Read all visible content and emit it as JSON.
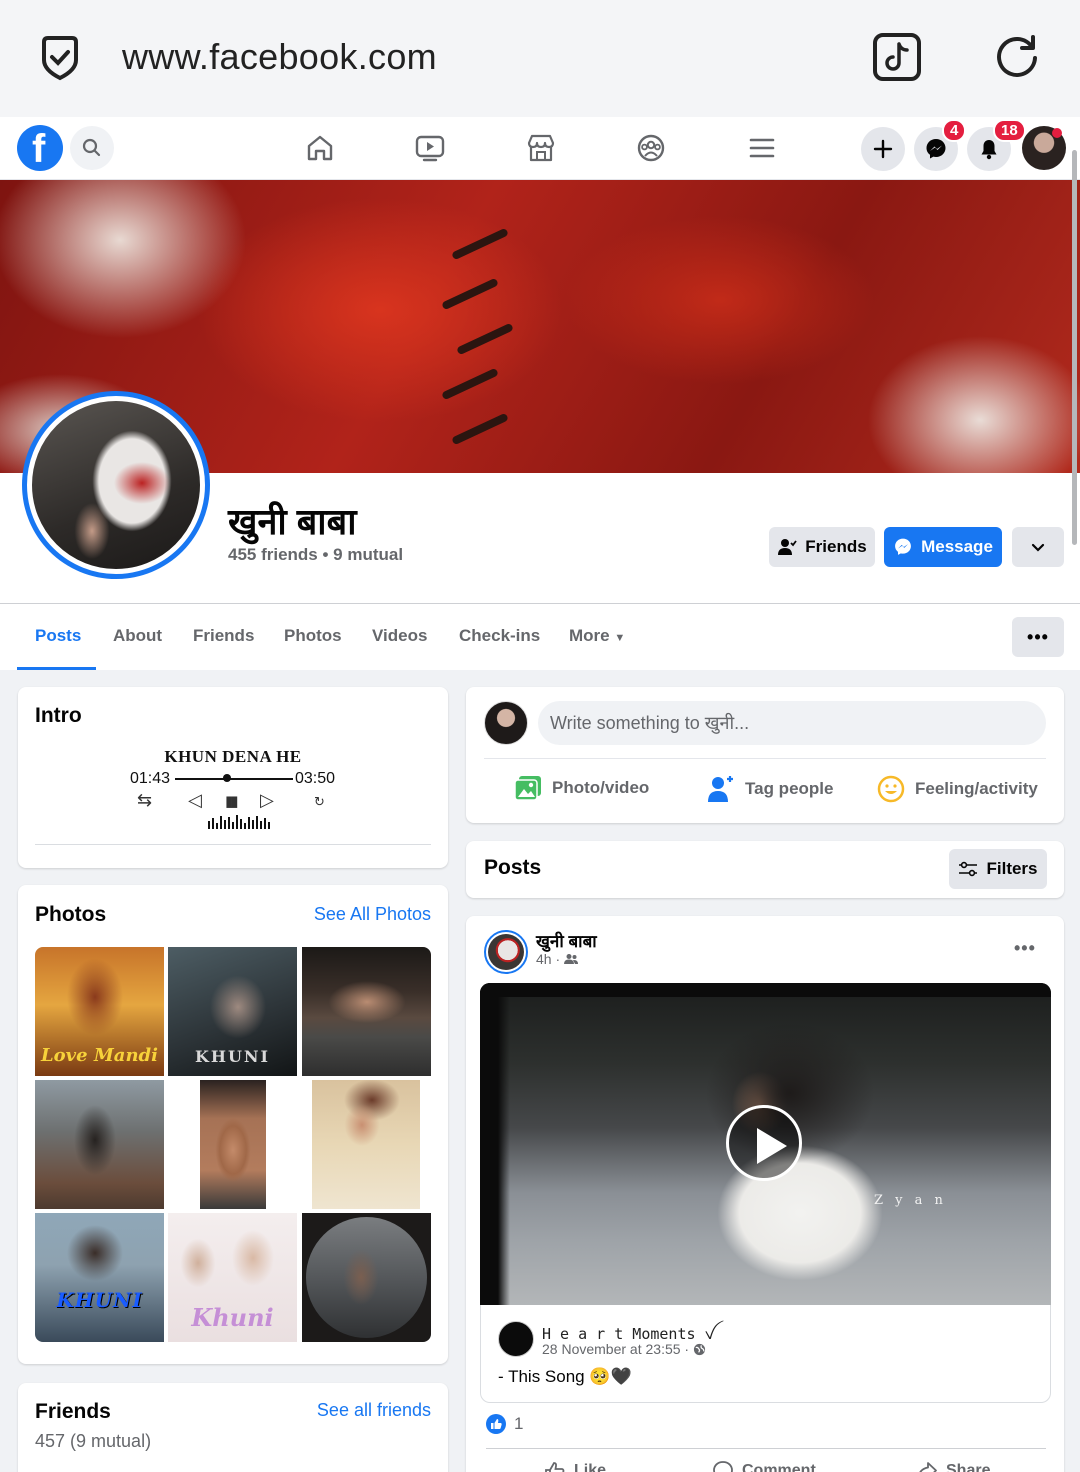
{
  "browser": {
    "url": "www.facebook.com",
    "icons": [
      "shield-check-icon",
      "tiktok-icon",
      "reload-icon"
    ]
  },
  "header": {
    "logo": "f",
    "nav_icons": [
      "home-icon",
      "watch-icon",
      "marketplace-icon",
      "groups-icon",
      "menu-icon"
    ],
    "create_icon": "plus-icon",
    "messenger_badge": "4",
    "notifications_badge": "18"
  },
  "profile": {
    "name": "खुनी बाबा",
    "meta": "455 friends • 9 mutual",
    "friends_button": "Friends",
    "message_button": "Message"
  },
  "tabs": {
    "items": [
      "Posts",
      "About",
      "Friends",
      "Photos",
      "Videos",
      "Check-ins",
      "More"
    ],
    "active": "Posts",
    "more_options": "•••"
  },
  "intro": {
    "title": "Intro",
    "music": {
      "song": "KHUN DENA HE",
      "elapsed": "01:43",
      "duration": "03:50",
      "progress_fraction": 0.45,
      "shuffle": "⇆",
      "prev": "◁",
      "pause": "▮▮",
      "next": "▷",
      "repeat": "↻"
    }
  },
  "photos": {
    "title": "Photos",
    "see_all": "See All Photos",
    "overlays": [
      "Love Mandi",
      "KHUNI",
      "",
      "",
      "",
      "",
      "KHUNI",
      "Khuni",
      ""
    ]
  },
  "friends": {
    "title": "Friends",
    "see_all": "See all friends",
    "count": "457 (9 mutual)"
  },
  "composer": {
    "placeholder": "Write something to खुनी...",
    "photo_video": "Photo/video",
    "tag_people": "Tag people",
    "feeling": "Feeling/activity"
  },
  "posts_header": {
    "title": "Posts",
    "filters": "Filters"
  },
  "post": {
    "author": "खुनी बाबा",
    "time": "4h ·",
    "watermark": "Z y a n",
    "shared_author": "H e a r t  Moments ꪜ",
    "shared_time": "28 November at 23:55 ·",
    "caption": "- This Song 🥺🖤",
    "likes": "1",
    "like_label": "Like",
    "comment_label": "Comment",
    "share_label": "Share"
  },
  "colors": {
    "brand": "#1877f2",
    "badge": "#e41e3f",
    "page_bg": "#f0f2f5"
  }
}
